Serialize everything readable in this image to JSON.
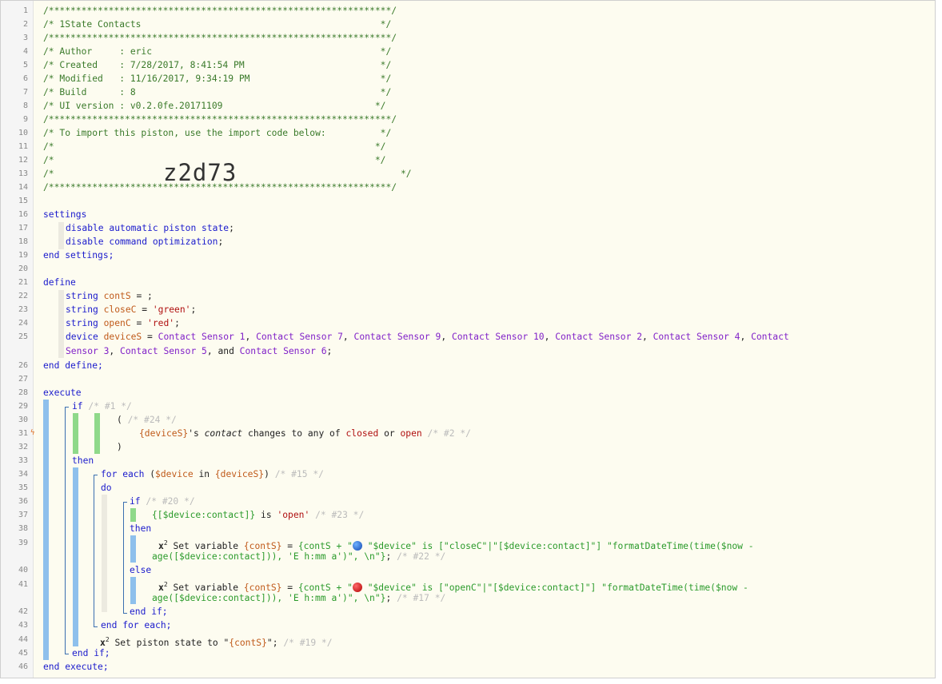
{
  "header": {
    "stars": "/***************************************************************/",
    "title": "/* 1State Contacts                                            */",
    "author": "/* Author     : eric                                          */",
    "created": "/* Created    : 7/28/2017, 8:41:54 PM                         */",
    "modified": "/* Modified   : 11/16/2017, 9:34:19 PM                        */",
    "build": "/* Build      : 8                                             */",
    "ui_version": "/* UI version : v0.2.0fe.20171109                            */",
    "import_note": "/* To import this piston, use the import code below:          */",
    "blank_comment": "/*                                                           */",
    "code_prefix": "/*              ",
    "import_code": "z2d73",
    "code_suffix": "*/"
  },
  "line_numbers": [
    "1",
    "2",
    "3",
    "4",
    "5",
    "6",
    "7",
    "8",
    "9",
    "10",
    "11",
    "12",
    "13",
    "14",
    "15",
    "16",
    "17",
    "18",
    "19",
    "20",
    "21",
    "22",
    "23",
    "24",
    "25",
    "26",
    "27",
    "28",
    "29",
    "30",
    "31",
    "32",
    "33",
    "34",
    "35",
    "36",
    "37",
    "38",
    "39",
    "40",
    "41",
    "42",
    "43",
    "44",
    "45",
    "46"
  ],
  "settings": {
    "open": "settings",
    "l1a": "disable",
    "l1b": "automatic piston state",
    "l1c": ";",
    "l2a": "disable",
    "l2b": "command optimization",
    "l2c": ";",
    "close": "end settings;"
  },
  "define": {
    "open": "define",
    "string_kw": "string",
    "device_kw": "device",
    "v1": "contS",
    "v1_tail": " = ;",
    "v2": "closeC",
    "v2_val": "'green'",
    "v3": "openC",
    "v3_val": "'red'",
    "v4": "deviceS",
    "eq": " = ",
    "semi": ";",
    "devices_line1": [
      "Contact Sensor 1",
      "Contact Sensor 7",
      "Contact Sensor 9",
      "Contact Sensor 10",
      "Contact Sensor 2",
      "Contact Sensor 4",
      "Contact"
    ],
    "devices_line2": [
      "Sensor 3",
      "Contact Sensor 5",
      "Contact Sensor 6"
    ],
    "comma": ", ",
    "and": ", and ",
    "close": "end define;"
  },
  "execute": {
    "open": "execute",
    "if": "if",
    "c1": "/* #1 */",
    "paren_open": "(",
    "c24": "/* #24 */",
    "trigger_dev": "{deviceS}",
    "trigger_s": "'s ",
    "trigger_attr": "contact",
    "trigger_op": " changes to any of ",
    "closed": "closed",
    "or": " or ",
    "open_val": "open",
    "c2": "/* #2 */",
    "paren_close": ")",
    "then": "then",
    "for_each": "for each",
    "for_paren": "(",
    "for_var": "$device",
    "for_in": " in ",
    "for_dev": "{deviceS}",
    "for_close": ")",
    "c15": "/* #15 */",
    "do": "do",
    "inner_if": "if",
    "c20": "/* #20 */",
    "cond_expr": "{[$device:contact]}",
    "cond_is": " is ",
    "cond_val": "'open'",
    "c23": "/* #23 */",
    "inner_then": "then",
    "x2": "x",
    "sup": "2",
    "set_var": " Set variable ",
    "contS": "{contS}",
    "assign": " = ",
    "expr_a": "{contS + \"",
    "expr1_b": " \"$device\" is [\"closeC\"|\"[$device:contact]\"] \"formatDateTime(time($now -",
    "expr2_b": " \"$device\" is [\"openC\"|\"[$device:contact]\"] \"formatDateTime(time($now -",
    "expr_c": "age([$device:contact])), 'E h:mm a')\", \\n\"}",
    "c22": "/* #22 */",
    "else": "else",
    "c17": "/* #17 */",
    "end_if_inner": "end if;",
    "end_for": "end for each;",
    "set_state": " Set piston state to \"",
    "state_var": "{contS}",
    "state_end": "\";",
    "c19": "/* #19 */",
    "end_if": "end if;",
    "close": "end execute;"
  },
  "icons": {
    "trigger": "lightning-icon"
  },
  "colors": {
    "keyword": "#1a1acc",
    "variable": "#c05a1a",
    "string": "#b01010",
    "device": "#8020c8",
    "expression": "#2a9a2a",
    "comment": "#bbbbbb"
  }
}
